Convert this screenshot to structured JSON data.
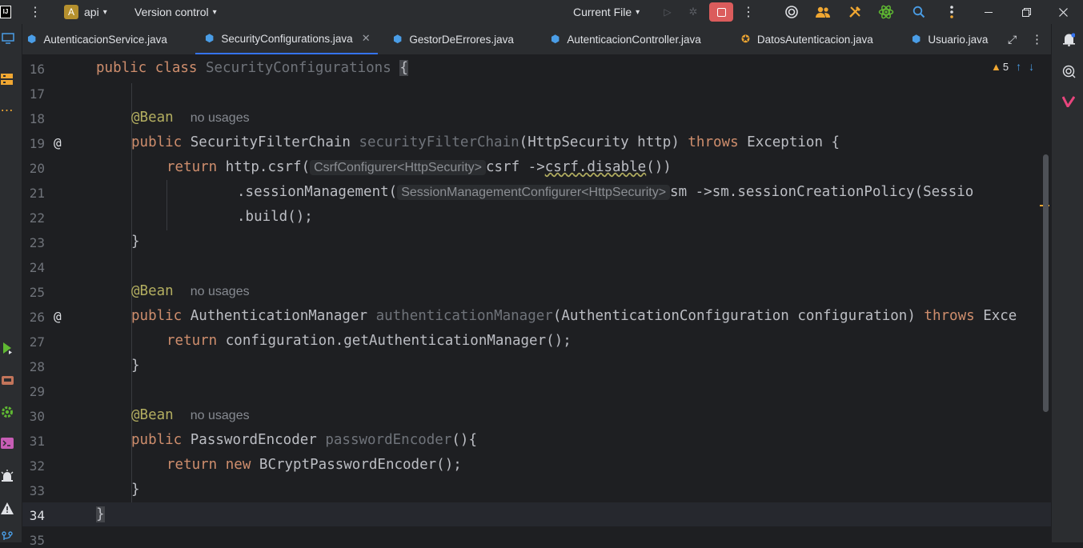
{
  "titlebar": {
    "app_letter": "A",
    "project": "api",
    "vcs": "Version control",
    "run_config": "Current File"
  },
  "tabs": [
    {
      "label": "AutenticacionService.java",
      "active": false
    },
    {
      "label": "SecurityConfigurations.java",
      "active": true
    },
    {
      "label": "GestorDeErrores.java",
      "active": false
    },
    {
      "label": "AutenticacionController.java",
      "active": false
    },
    {
      "label": "DatosAutenticacion.java",
      "active": false
    },
    {
      "label": "Usuario.java",
      "active": false
    }
  ],
  "editor": {
    "warnings_count": "5",
    "line_numbers": [
      "16",
      "17",
      "18",
      "19",
      "20",
      "21",
      "22",
      "23",
      "24",
      "25",
      "26",
      "27",
      "28",
      "29",
      "30",
      "31",
      "32",
      "33",
      "34",
      "35"
    ],
    "usage_hint": "no usages",
    "hints": {
      "csrf": "CsrfConfigurer<HttpSecurity>",
      "session": "SessionManagementConfigurer<HttpSecurity>"
    }
  },
  "colors": {
    "background": "#1e1f22",
    "panel": "#2b2d30",
    "keyword": "#cf8e6d",
    "annotation": "#b3ae60",
    "accent": "#3574f0",
    "stop": "#db5c5c"
  }
}
